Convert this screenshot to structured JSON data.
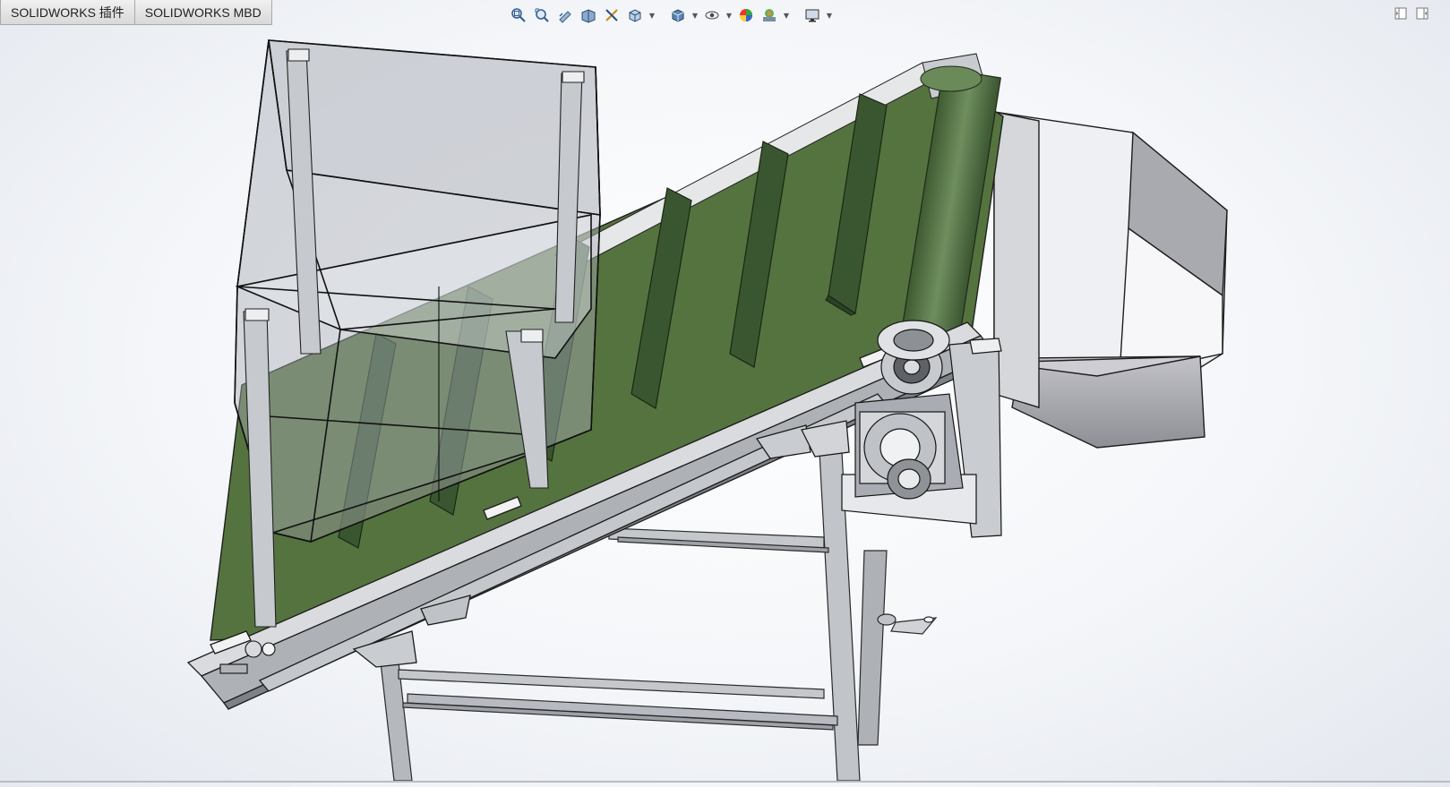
{
  "tabs": [
    {
      "label": "SOLIDWORKS 插件"
    },
    {
      "label": "SOLIDWORKS MBD"
    }
  ],
  "heads_up_toolbar": [
    {
      "icon": "zoom-to-fit-icon"
    },
    {
      "icon": "zoom-to-area-icon"
    },
    {
      "icon": "previous-view-icon"
    },
    {
      "icon": "section-view-icon"
    },
    {
      "icon": "dynamic-annotation-icon"
    },
    {
      "icon": "view-orientation-icon"
    },
    {
      "icon": "display-style-icon"
    },
    {
      "icon": "hide-show-items-icon"
    },
    {
      "icon": "edit-appearance-icon"
    },
    {
      "icon": "apply-scene-icon"
    },
    {
      "icon": "view-settings-icon"
    }
  ],
  "model": {
    "name": "inclined-cleated-belt-conveyor",
    "colors": {
      "belt": "#4f6e3f",
      "belt_dark": "#2f4526",
      "frame": "#b9bcc1",
      "frame_edge": "#2a2a2a",
      "hopper_glass": "#9aa0a8",
      "chute": "#a7a7ad",
      "background": "#f4f6f9"
    }
  }
}
